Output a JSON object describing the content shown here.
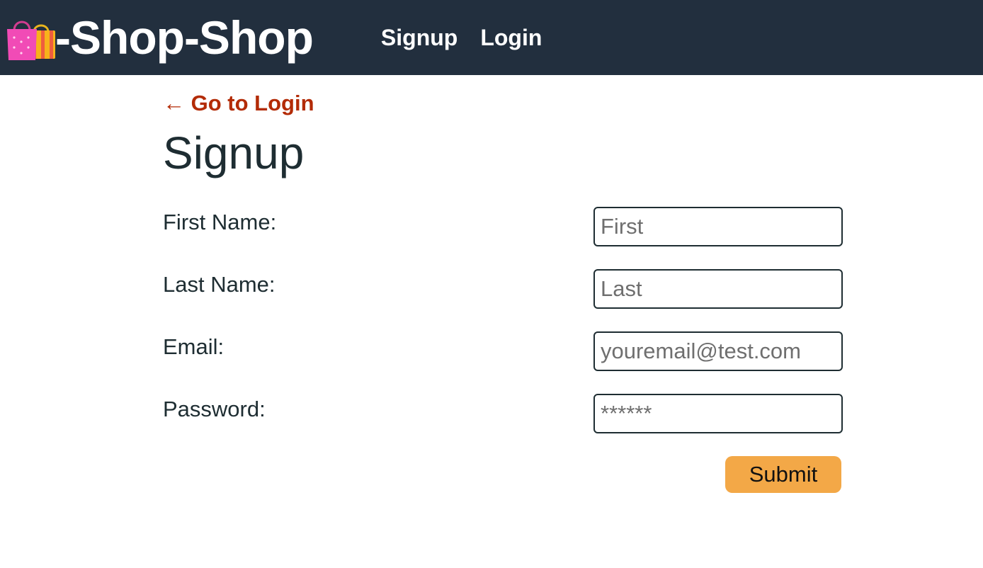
{
  "header": {
    "logo_icon": "shopping-bags-icon",
    "brand": "-Shop-Shop",
    "nav": [
      {
        "label": "Signup"
      },
      {
        "label": "Login"
      }
    ],
    "colors": {
      "background": "#222f3e",
      "text": "#ffffff"
    }
  },
  "main": {
    "back_link": "← Go to Login",
    "title": "Signup",
    "form": {
      "fields": [
        {
          "label": "First Name:",
          "placeholder": "First",
          "value": ""
        },
        {
          "label": "Last Name:",
          "placeholder": "Last",
          "value": ""
        },
        {
          "label": "Email:",
          "placeholder": "youremail@test.com",
          "value": ""
        },
        {
          "label": "Password:",
          "placeholder": "******",
          "value": ""
        }
      ],
      "submit_label": "Submit"
    },
    "colors": {
      "link": "#b32b06",
      "button": "#f3a847"
    }
  }
}
